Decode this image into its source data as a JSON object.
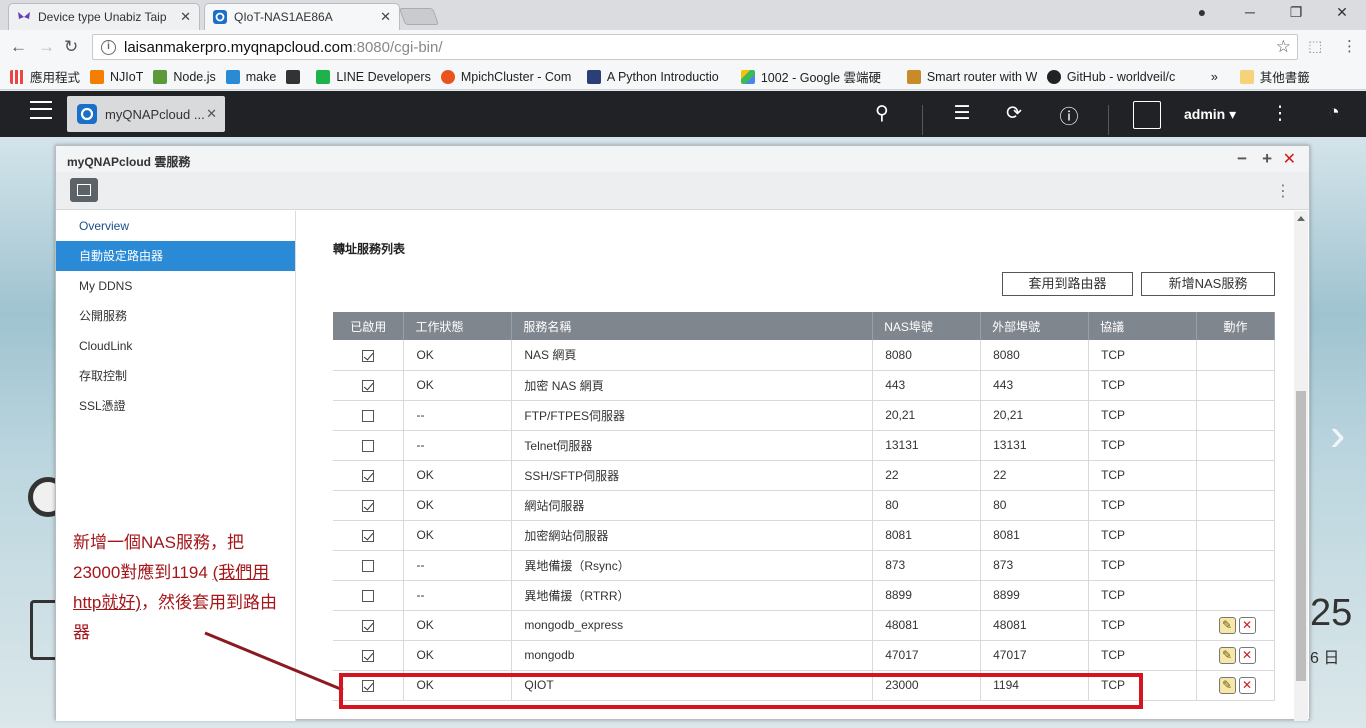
{
  "browser": {
    "tabs": [
      {
        "label": "Device type Unabiz Taip"
      },
      {
        "label": "QIoT-NAS1AE86A"
      }
    ],
    "url_host": "laisanmakerpro.myqnapcloud.com",
    "url_rest": ":8080/cgi-bin/",
    "bookmarks": [
      "應用程式",
      "NJIoT",
      "Node.js",
      "make",
      "",
      "LINE Developers",
      "MpichCluster - Com",
      "A Python Introductio",
      "1002 - Google 雲端硬",
      "Smart router with W",
      "GitHub - worldveil/c"
    ],
    "bookmarks_more": "»",
    "bookmarks_other": "其他書籤"
  },
  "qnap": {
    "app_tab": "myQNAPcloud ...",
    "user": "admin ▾"
  },
  "window": {
    "title": "myQNAPcloud 雲服務",
    "sidebar": [
      {
        "label": "Overview"
      },
      {
        "label": "自動設定路由器"
      },
      {
        "label": "My DDNS"
      },
      {
        "label": "公開服務"
      },
      {
        "label": "CloudLink"
      },
      {
        "label": "存取控制"
      },
      {
        "label": "SSL憑證"
      }
    ],
    "section_title": "轉址服務列表",
    "apply_button": "套用到路由器",
    "add_button": "新增NAS服務",
    "columns": [
      "已啟用",
      "工作狀態",
      "服務名稱",
      "NAS埠號",
      "外部埠號",
      "協議",
      "動作"
    ],
    "rows": [
      {
        "enabled": true,
        "status": "OK",
        "name": "NAS 網頁",
        "nas_port": "8080",
        "ext_port": "8080",
        "proto": "TCP",
        "actions": false
      },
      {
        "enabled": true,
        "status": "OK",
        "name": "加密 NAS 網頁",
        "nas_port": "443",
        "ext_port": "443",
        "proto": "TCP",
        "actions": false
      },
      {
        "enabled": false,
        "status": "--",
        "name": "FTP/FTPES伺服器",
        "nas_port": "20,21",
        "ext_port": "20,21",
        "proto": "TCP",
        "actions": false
      },
      {
        "enabled": false,
        "status": "--",
        "name": "Telnet伺服器",
        "nas_port": "13131",
        "ext_port": "13131",
        "proto": "TCP",
        "actions": false
      },
      {
        "enabled": true,
        "status": "OK",
        "name": "SSH/SFTP伺服器",
        "nas_port": "22",
        "ext_port": "22",
        "proto": "TCP",
        "actions": false
      },
      {
        "enabled": true,
        "status": "OK",
        "name": "網站伺服器",
        "nas_port": "80",
        "ext_port": "80",
        "proto": "TCP",
        "actions": false
      },
      {
        "enabled": true,
        "status": "OK",
        "name": "加密網站伺服器",
        "nas_port": "8081",
        "ext_port": "8081",
        "proto": "TCP",
        "actions": false
      },
      {
        "enabled": false,
        "status": "--",
        "name": "異地備援（Rsync）",
        "nas_port": "873",
        "ext_port": "873",
        "proto": "TCP",
        "actions": false
      },
      {
        "enabled": false,
        "status": "--",
        "name": "異地備援（RTRR）",
        "nas_port": "8899",
        "ext_port": "8899",
        "proto": "TCP",
        "actions": false
      },
      {
        "enabled": true,
        "status": "OK",
        "name": "mongodb_express",
        "nas_port": "48081",
        "ext_port": "48081",
        "proto": "TCP",
        "actions": true
      },
      {
        "enabled": true,
        "status": "OK",
        "name": "mongodb",
        "nas_port": "47017",
        "ext_port": "47017",
        "proto": "TCP",
        "actions": true
      },
      {
        "enabled": true,
        "status": "OK",
        "name": "QIOT",
        "nas_port": "23000",
        "ext_port": "1194",
        "proto": "TCP",
        "actions": true
      }
    ]
  },
  "annotation": {
    "line1": "新增一個NAS服務，把",
    "line2a": "23000對應到1194 ",
    "line2b": "(我們用",
    "line3a": "http就好)",
    "line3b": "，然後套用到路由",
    "line4": "器"
  },
  "desktop": {
    "clock_partial": "25",
    "date_partial": "6 日"
  },
  "colors": {
    "accent": "#2b8ad6",
    "highlight": "#d4151f",
    "note": "#a4161a"
  }
}
